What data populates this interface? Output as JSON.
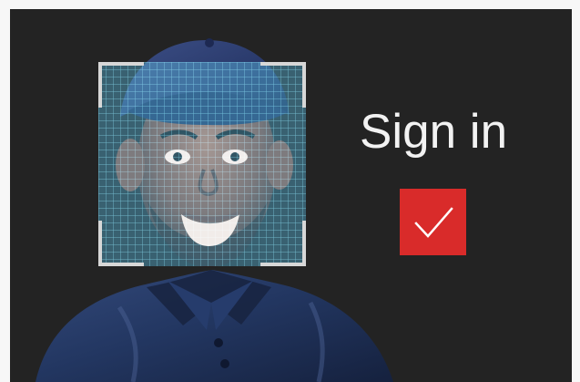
{
  "screen": {
    "title": "Sign in"
  },
  "status": {
    "icon": "checkmark-icon",
    "color": "#d92b2a"
  },
  "scan": {
    "frame_color": "#d7d7d7",
    "grid_color": "#3b94b6"
  }
}
